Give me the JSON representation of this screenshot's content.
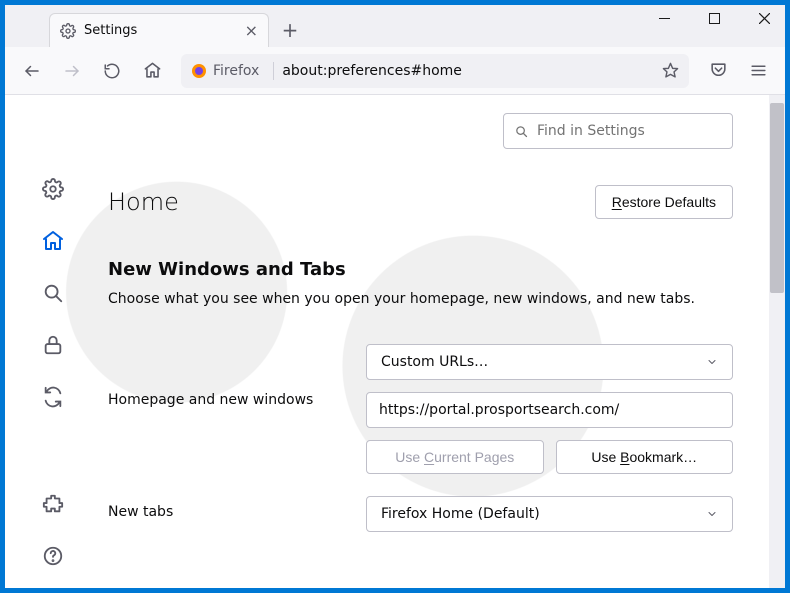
{
  "titlebar": {
    "tab": {
      "label": "Settings"
    },
    "newtab_glyph": "+"
  },
  "navbar": {
    "identity_label": "Firefox",
    "url": "about:preferences#home"
  },
  "sidebar": {
    "items": [
      {
        "name": "general",
        "icon": "gear-icon"
      },
      {
        "name": "home",
        "icon": "home-icon"
      },
      {
        "name": "search",
        "icon": "search-icon"
      },
      {
        "name": "privacy",
        "icon": "lock-icon"
      },
      {
        "name": "sync",
        "icon": "sync-icon"
      }
    ],
    "bottom": [
      {
        "name": "extensions",
        "icon": "puzzle-icon"
      },
      {
        "name": "help",
        "icon": "help-icon"
      }
    ]
  },
  "main": {
    "find_placeholder": "Find in Settings",
    "page_title": "Home",
    "restore_defaults_label": "Restore Defaults",
    "section_title": "New Windows and Tabs",
    "section_desc": "Choose what you see when you open your homepage, new windows, and new tabs.",
    "homepage": {
      "row_label": "Homepage and new windows",
      "select_value": "Custom URLs…",
      "url_value": "https://portal.prosportsearch.com/",
      "use_current_label": "Use Current Pages",
      "use_bookmark_label": "Use Bookmark…"
    },
    "newtabs": {
      "row_label": "New tabs",
      "select_value": "Firefox Home (Default)"
    }
  }
}
